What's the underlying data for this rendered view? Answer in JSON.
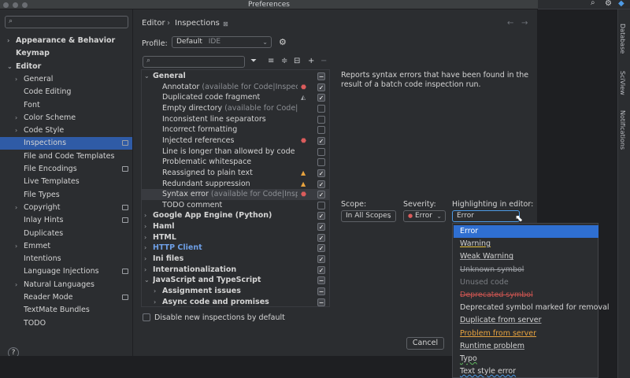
{
  "window": {
    "title": "Preferences"
  },
  "sidebar": {
    "search_placeholder": "",
    "items": [
      {
        "label": "Appearance & Behavior",
        "indent": 0,
        "arrow": "right",
        "bold": true
      },
      {
        "label": "Keymap",
        "indent": 0,
        "arrow": "",
        "bold": true
      },
      {
        "label": "Editor",
        "indent": 0,
        "arrow": "down",
        "bold": true
      },
      {
        "label": "General",
        "indent": 1,
        "arrow": "right"
      },
      {
        "label": "Code Editing",
        "indent": 1,
        "arrow": ""
      },
      {
        "label": "Font",
        "indent": 1,
        "arrow": ""
      },
      {
        "label": "Color Scheme",
        "indent": 1,
        "arrow": "right"
      },
      {
        "label": "Code Style",
        "indent": 1,
        "arrow": "right"
      },
      {
        "label": "Inspections",
        "indent": 1,
        "arrow": "",
        "selected": true,
        "badge": true
      },
      {
        "label": "File and Code Templates",
        "indent": 1,
        "arrow": ""
      },
      {
        "label": "File Encodings",
        "indent": 1,
        "arrow": "",
        "badge": true
      },
      {
        "label": "Live Templates",
        "indent": 1,
        "arrow": ""
      },
      {
        "label": "File Types",
        "indent": 1,
        "arrow": ""
      },
      {
        "label": "Copyright",
        "indent": 1,
        "arrow": "right",
        "badge": true
      },
      {
        "label": "Inlay Hints",
        "indent": 1,
        "arrow": "",
        "badge": true
      },
      {
        "label": "Duplicates",
        "indent": 1,
        "arrow": ""
      },
      {
        "label": "Emmet",
        "indent": 1,
        "arrow": "right"
      },
      {
        "label": "Intentions",
        "indent": 1,
        "arrow": ""
      },
      {
        "label": "Language Injections",
        "indent": 1,
        "arrow": "",
        "badge": true
      },
      {
        "label": "Natural Languages",
        "indent": 1,
        "arrow": "right"
      },
      {
        "label": "Reader Mode",
        "indent": 1,
        "arrow": "",
        "badge": true
      },
      {
        "label": "TextMate Bundles",
        "indent": 1,
        "arrow": ""
      },
      {
        "label": "TODO",
        "indent": 1,
        "arrow": ""
      }
    ],
    "help": "?"
  },
  "breadcrumb": {
    "parent": "Editor",
    "sep": "›",
    "current": "Inspections"
  },
  "profile": {
    "label": "Profile:",
    "value": "Default",
    "scope": "IDE"
  },
  "inspections": [
    {
      "type": "group",
      "label": "General",
      "arrow": "down",
      "check": "partial"
    },
    {
      "type": "item",
      "label": "Annotator",
      "hint": " (available for Code|Inspect Cod",
      "sev": "err",
      "check": "on"
    },
    {
      "type": "item",
      "label": "Duplicated code fragment",
      "hint": "",
      "sev": "weak",
      "check": "on"
    },
    {
      "type": "item",
      "label": "Empty directory",
      "hint": " (available for Code|Inspe",
      "sev": "",
      "check": "off"
    },
    {
      "type": "item",
      "label": "Inconsistent line separators",
      "hint": "",
      "sev": "",
      "check": "off"
    },
    {
      "type": "item",
      "label": "Incorrect formatting",
      "hint": "",
      "sev": "",
      "check": "off"
    },
    {
      "type": "item",
      "label": "Injected references",
      "hint": "",
      "sev": "err",
      "check": "on"
    },
    {
      "type": "item",
      "label": "Line is longer than allowed by code style",
      "hint": "",
      "sev": "",
      "check": "off"
    },
    {
      "type": "item",
      "label": "Problematic whitespace",
      "hint": "",
      "sev": "",
      "check": "off"
    },
    {
      "type": "item",
      "label": "Reassigned to plain text",
      "hint": "",
      "sev": "warn",
      "check": "on"
    },
    {
      "type": "item",
      "label": "Redundant suppression",
      "hint": "",
      "sev": "warn",
      "check": "on"
    },
    {
      "type": "item",
      "label": "Syntax error",
      "hint": " (available for Code|Inspect C",
      "sev": "err",
      "check": "on",
      "selected": true
    },
    {
      "type": "item",
      "label": "TODO comment",
      "hint": "",
      "sev": "",
      "check": "off"
    },
    {
      "type": "group",
      "label": "Google App Engine (Python)",
      "arrow": "right",
      "check": "on"
    },
    {
      "type": "group",
      "label": "Haml",
      "arrow": "right",
      "check": "on"
    },
    {
      "type": "group",
      "label": "HTML",
      "arrow": "right",
      "check": "on"
    },
    {
      "type": "group",
      "label": "HTTP Client",
      "arrow": "right",
      "check": "on",
      "link": true
    },
    {
      "type": "group",
      "label": "Ini files",
      "arrow": "right",
      "check": "on"
    },
    {
      "type": "group",
      "label": "Internationalization",
      "arrow": "right",
      "check": "on"
    },
    {
      "type": "group",
      "label": "JavaScript and TypeScript",
      "arrow": "down",
      "check": "partial"
    },
    {
      "type": "subgroup",
      "label": "Assignment issues",
      "arrow": "right",
      "check": "partial"
    },
    {
      "type": "subgroup",
      "label": "Async code and promises",
      "arrow": "right",
      "check": "partial"
    }
  ],
  "description": "Reports syntax errors that have been found in the result of a batch code inspection run.",
  "scope": {
    "label": "Scope:",
    "value": "In All Scopes"
  },
  "severity": {
    "label": "Severity:",
    "value": "Error"
  },
  "highlighting": {
    "label": "Highlighting in editor:",
    "value": "Error"
  },
  "dropdown_options": [
    {
      "label": "Error",
      "style": "sel"
    },
    {
      "label": "Warning",
      "style": "u-yellow"
    },
    {
      "label": "Weak Warning",
      "style": "u-gray"
    },
    {
      "label": "Unknown symbol",
      "style": "strike-gray"
    },
    {
      "label": "Unused code",
      "style": "dim"
    },
    {
      "label": "Deprecated symbol",
      "style": "strike-red"
    },
    {
      "label": "Deprecated symbol marked for removal",
      "style": "plain"
    },
    {
      "label": "Duplicate from server",
      "style": "u-gray"
    },
    {
      "label": "Problem from server",
      "style": "u-orange"
    },
    {
      "label": "Runtime problem",
      "style": "u-gray"
    },
    {
      "label": "Typo",
      "style": "wavy-green"
    },
    {
      "label": "Text style error",
      "style": "wavy-blue"
    }
  ],
  "disable_new": {
    "label": "Disable new inspections by default"
  },
  "buttons": {
    "cancel": "Cancel"
  },
  "right_panel": {
    "tabs": [
      "Database",
      "SciView",
      "Notifications"
    ]
  },
  "colors": {
    "accent": "#2f5ba6",
    "dropdown_selected": "#2f6fd1",
    "error": "#db5c5c",
    "warning": "#e8a33e"
  }
}
